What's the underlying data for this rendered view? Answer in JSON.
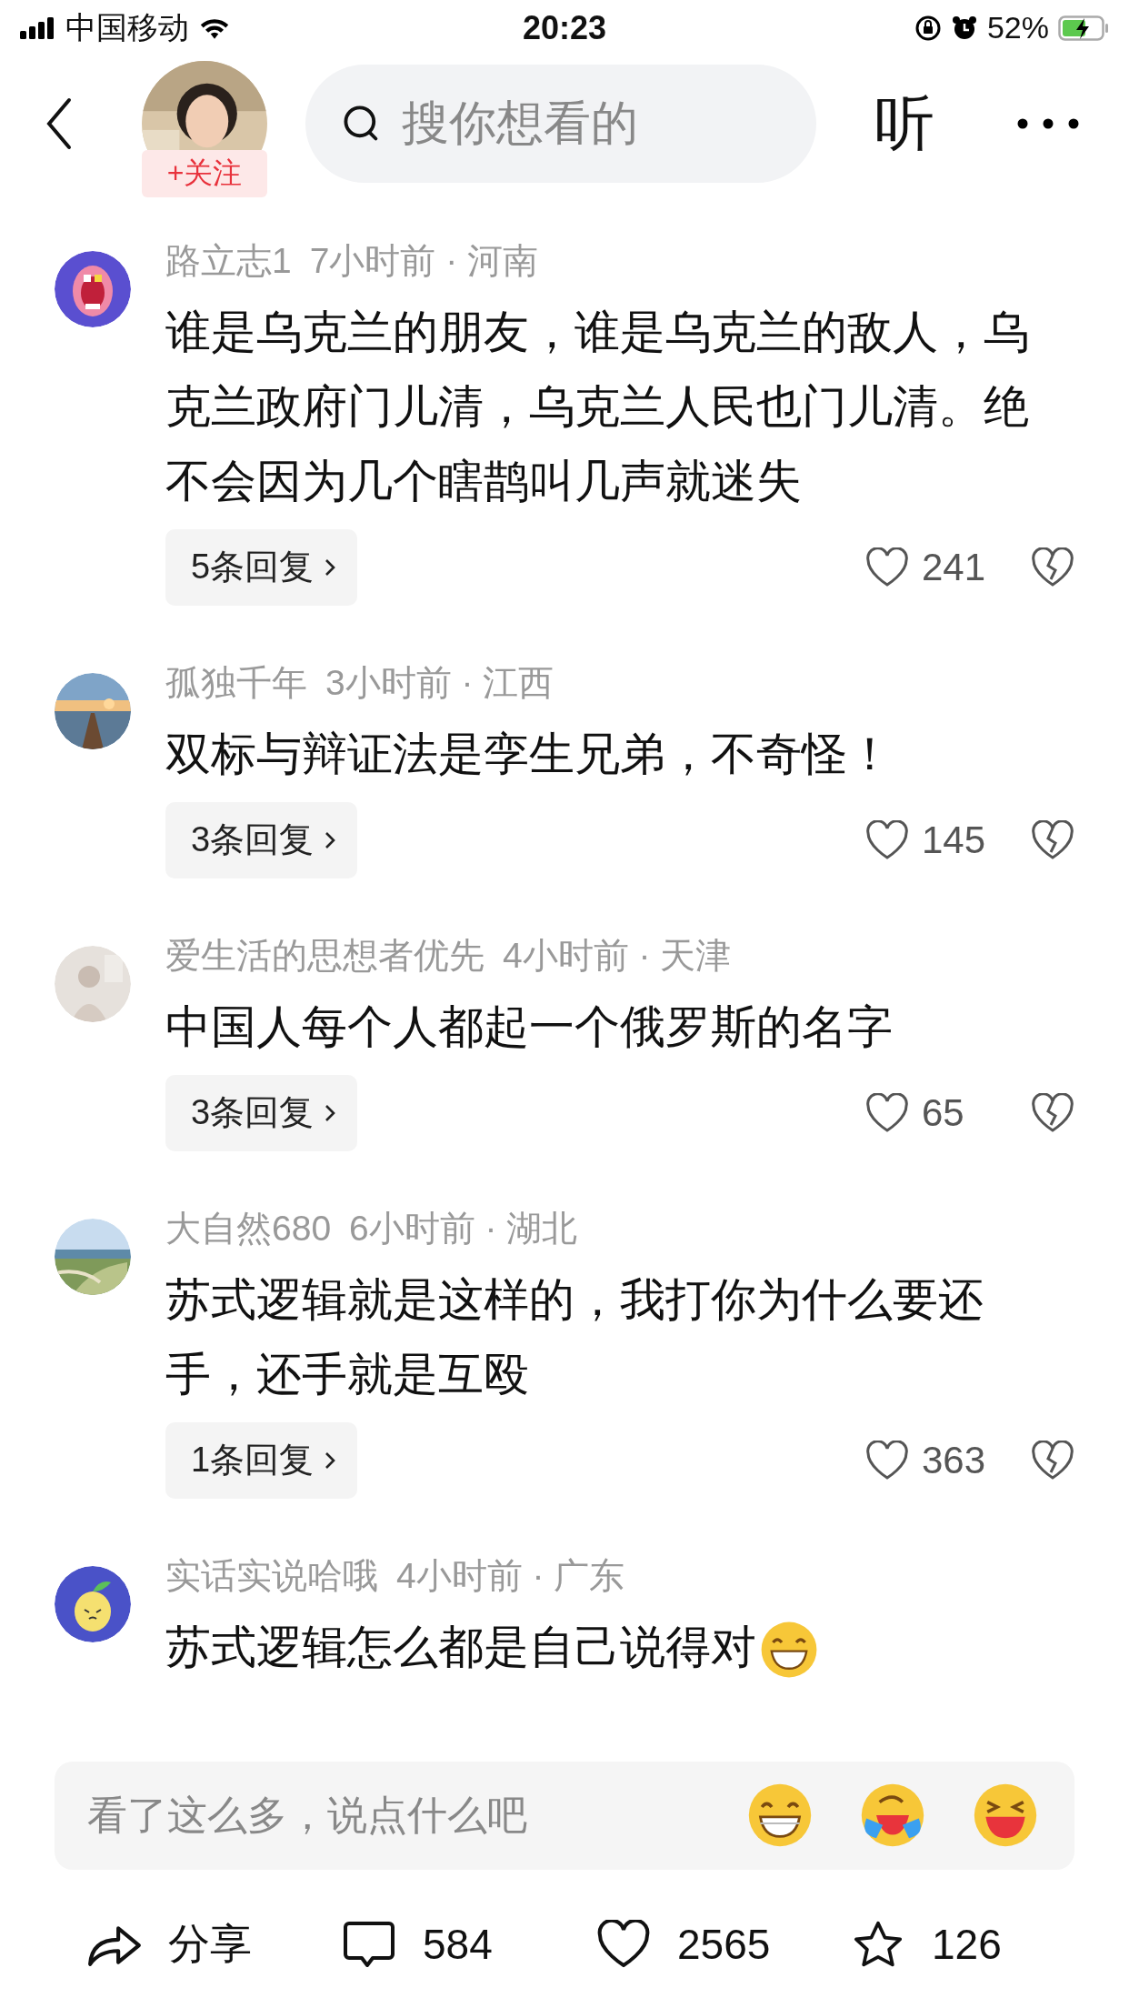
{
  "status_bar": {
    "carrier": "中国移动",
    "time": "20:23",
    "battery": "52%"
  },
  "header": {
    "follow": "+关注",
    "search": {
      "placeholder": "搜你想看的"
    },
    "listen": "听"
  },
  "comments": [
    {
      "user": "路立志1",
      "meta": "7小时前 · 河南",
      "text": "谁是乌克兰的朋友，谁是乌克兰的敌人，乌克兰政府门儿清，乌克兰人民也门儿清。绝不会因为几个瞎鹊叫几声就迷失",
      "replies": "5条回复",
      "likes": "241"
    },
    {
      "user": "孤独千年",
      "meta": "3小时前 · 江西",
      "text": "双标与辩证法是孪生兄弟，不奇怪！",
      "replies": "3条回复",
      "likes": "145"
    },
    {
      "user": "爱生活的思想者优先",
      "meta": "4小时前 · 天津",
      "text": "中国人每个人都起一个俄罗斯的名字",
      "replies": "3条回复",
      "likes": "65"
    },
    {
      "user": "大自然680",
      "meta": "6小时前 · 湖北",
      "text": "苏式逻辑就是这样的，我打你为什么要还手，还手就是互殴",
      "replies": "1条回复",
      "likes": "363"
    },
    {
      "user": "实话实说哈哦",
      "meta": "4小时前 · 广东",
      "text": "苏式逻辑怎么都是自己说得对",
      "emoji": true
    }
  ],
  "comment_input": {
    "placeholder": "看了这么多，说点什么吧"
  },
  "bottom_bar": {
    "share": "分享",
    "comments": "584",
    "likes": "2565",
    "favorites": "126"
  }
}
